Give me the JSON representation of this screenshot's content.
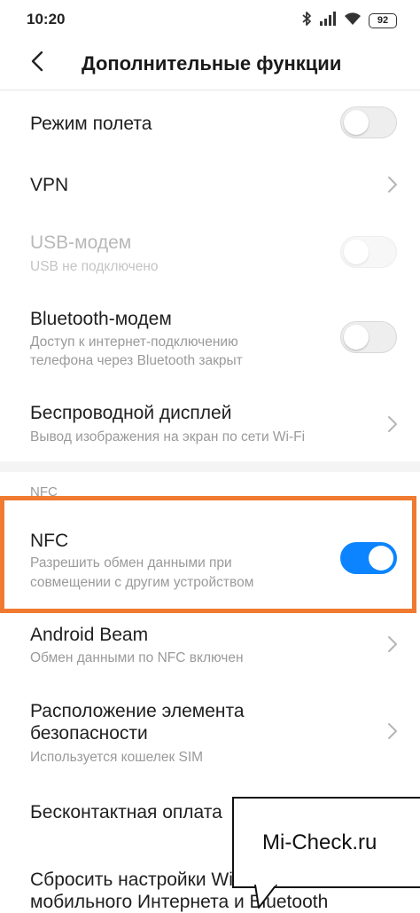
{
  "status_bar": {
    "time": "10:20",
    "battery": "92",
    "icons": [
      "bluetooth-icon",
      "signal-icon",
      "wifi-icon",
      "battery-icon"
    ]
  },
  "header": {
    "title": "Дополнительные функции",
    "back_icon": "chevron-left-icon"
  },
  "items": [
    {
      "label": "Режим полета",
      "control": "toggle",
      "state": "off"
    },
    {
      "label": "VPN",
      "control": "chevron"
    },
    {
      "label": "USB-модем",
      "subtitle": "USB не подключено",
      "control": "toggle",
      "state": "off",
      "disabled": true
    },
    {
      "label": "Bluetooth-модем",
      "subtitle_line1": "Доступ к интернет-подключению",
      "subtitle_line2": "телефона через Bluetooth закрыт",
      "control": "toggle",
      "state": "off"
    },
    {
      "label": "Беспроводной дисплей",
      "subtitle": "Вывод изображения на экран по сети Wi-Fi",
      "control": "chevron"
    }
  ],
  "nfc_section": {
    "header": "NFC",
    "items": [
      {
        "label": "NFC",
        "subtitle_line1": "Разрешить обмен данными при",
        "subtitle_line2": "совмещении с другим устройством",
        "control": "toggle",
        "state": "on"
      },
      {
        "label": "Android Beam",
        "subtitle": "Обмен данными по NFC включен",
        "control": "chevron"
      },
      {
        "label_line1": "Расположение элемента",
        "label_line2": "безопасности",
        "subtitle": "Используется кошелек SIM",
        "control": "chevron"
      },
      {
        "label": "Бесконтактная оплата",
        "control": "chevron"
      },
      {
        "label_line1": "Сбросить настройки Wi-Fi,",
        "label_line2": "мобильного Интернета и Bluetooth",
        "control": "none"
      }
    ]
  },
  "watermark": {
    "text": "Mi-Check.ru"
  },
  "colors": {
    "accent": "#0d84ff",
    "highlight": "#f07a2f",
    "text_primary": "#1f1f1f",
    "text_secondary": "#9a9a9a",
    "divider": "#e6e6e6"
  }
}
